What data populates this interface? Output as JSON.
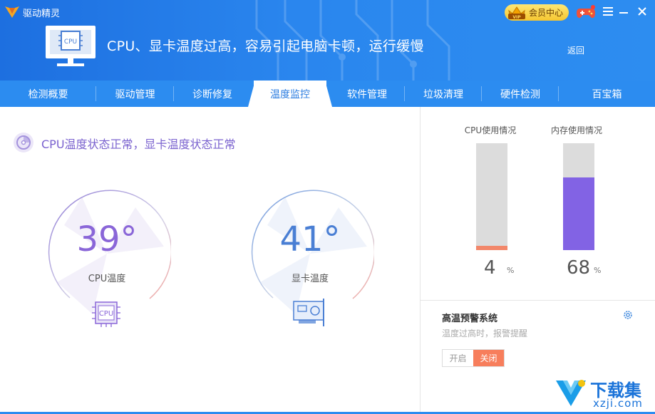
{
  "window": {
    "app_name": "驱动精灵"
  },
  "header": {
    "hero_icon_label": "CPU",
    "hero_text": "CPU、显卡温度过高，容易引起电脑卡顿，运行缓慢",
    "back_label": "返回",
    "vip_badge": "VIP",
    "vip_label": "会员中心"
  },
  "tabs": [
    {
      "label": "检测概要"
    },
    {
      "label": "驱动管理"
    },
    {
      "label": "诊断修复"
    },
    {
      "label": "温度监控",
      "active": true
    },
    {
      "label": "软件管理"
    },
    {
      "label": "垃圾清理"
    },
    {
      "label": "硬件检测"
    },
    {
      "label": "百宝箱"
    }
  ],
  "status": {
    "text": "CPU温度状态正常，显卡温度状态正常"
  },
  "gauges": {
    "cpu": {
      "value": "39°",
      "label": "CPU温度",
      "chip_label": "CPU",
      "color": "#8a66d8"
    },
    "gpu": {
      "value": "41°",
      "label": "显卡温度",
      "color": "#4a7fd4"
    }
  },
  "usage": {
    "cpu": {
      "title": "CPU使用情况",
      "value": "4",
      "unit": "%",
      "percent": 4,
      "color": "#f2876a"
    },
    "memory": {
      "title": "内存使用情况",
      "value": "68",
      "unit": "%",
      "percent": 68,
      "color": "#8263e4"
    }
  },
  "alert": {
    "title": "高温预警系统",
    "subtitle": "温度过高时，报警提醒",
    "on_label": "开启",
    "off_label": "关闭"
  },
  "watermark": {
    "title": "下载集",
    "url": "xzji.com"
  }
}
